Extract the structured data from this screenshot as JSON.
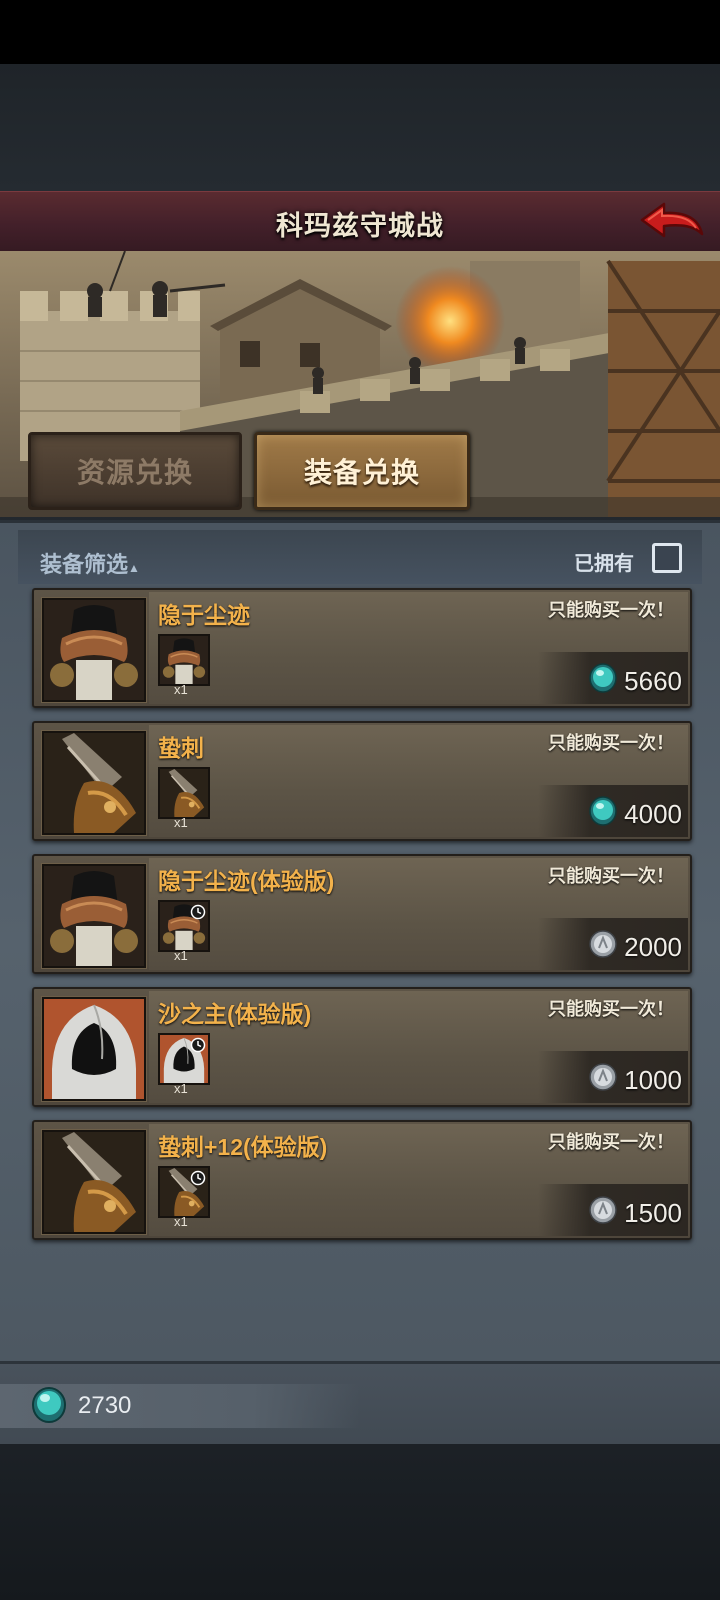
{
  "header": {
    "title": "科玛兹守城战",
    "back_icon": "back-arrow-icon"
  },
  "tabs": [
    {
      "label": "资源兑换",
      "active": false
    },
    {
      "label": "装备兑换",
      "active": true
    }
  ],
  "filter": {
    "label": "装备筛选",
    "sort_icon": "triangle-up-icon",
    "owned_label": "已拥有",
    "owned_checked": false
  },
  "items": [
    {
      "name": "隐于尘迹",
      "limit": "只能购买一次！",
      "qty": "x1",
      "price": "5660",
      "currency": "gem-icon",
      "trial": false,
      "art": "cloak"
    },
    {
      "name": "蛰刺",
      "limit": "只能购买一次！",
      "qty": "x1",
      "price": "4000",
      "currency": "gem-icon",
      "trial": false,
      "art": "gauntlet"
    },
    {
      "name": "隐于尘迹(体验版)",
      "limit": "只能购买一次！",
      "qty": "x1",
      "price": "2000",
      "currency": "silver-coin-icon",
      "trial": true,
      "art": "cloak"
    },
    {
      "name": "沙之主(体验版)",
      "limit": "只能购买一次！",
      "qty": "x1",
      "price": "1000",
      "currency": "silver-coin-icon",
      "trial": true,
      "art": "hood"
    },
    {
      "name": "蛰刺+12(体验版)",
      "limit": "只能购买一次！",
      "qty": "x1",
      "price": "1500",
      "currency": "silver-coin-icon",
      "trial": true,
      "art": "gauntlet"
    }
  ],
  "wallet": {
    "gem_amount": "2730",
    "icon": "gem-icon"
  },
  "colors": {
    "title_bar": "#43202a",
    "item_name": "#f3b24b",
    "gem": "#3fc9c0",
    "panel": "#56626d"
  }
}
